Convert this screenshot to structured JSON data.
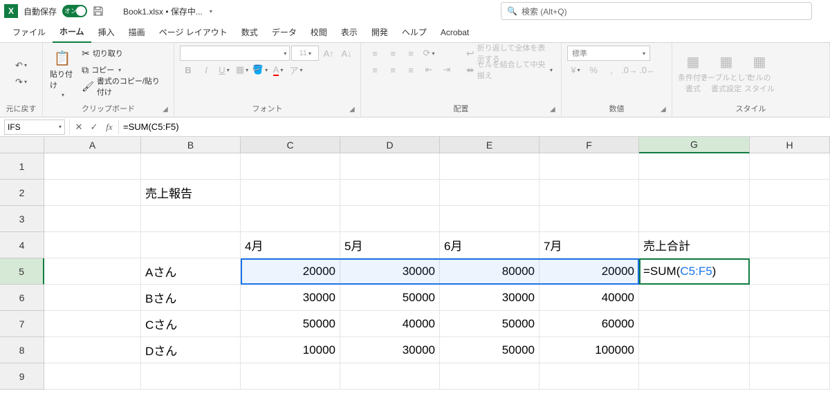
{
  "titlebar": {
    "autosave_label": "自動保存",
    "autosave_on": "オン",
    "file_title": "Book1.xlsx • 保存中...",
    "search_placeholder": "検索 (Alt+Q)"
  },
  "tabs": [
    "ファイル",
    "ホーム",
    "挿入",
    "描画",
    "ページ レイアウト",
    "数式",
    "データ",
    "校閲",
    "表示",
    "開発",
    "ヘルプ",
    "Acrobat"
  ],
  "active_tab": "ホーム",
  "ribbon": {
    "undo_label": "元に戻す",
    "clipboard": {
      "paste": "貼り付け",
      "cut": "切り取り",
      "copy": "コピー",
      "fmtpaint": "書式のコピー/貼り付け",
      "label": "クリップボード"
    },
    "font": {
      "size": "11",
      "label": "フォント"
    },
    "align": {
      "wrap": "折り返して全体を表示する",
      "merge": "セルを結合して中央揃え",
      "label": "配置"
    },
    "number": {
      "fmt": "標準",
      "label": "数値"
    },
    "styles": {
      "cond": "条件付き\n書式",
      "table": "テーブルとして\n書式設定",
      "cell": "セルの\nスタイル",
      "label": "スタイル"
    }
  },
  "name_box": "IFS",
  "formula": {
    "prefix": "=SUM(",
    "ref": "C5:F5",
    "suffix": ")"
  },
  "formula_text": "=SUM(C5:F5)",
  "columns": [
    "A",
    "B",
    "C",
    "D",
    "E",
    "F",
    "G",
    "H"
  ],
  "rows": [
    "1",
    "2",
    "3",
    "4",
    "5",
    "6",
    "7",
    "8",
    "9"
  ],
  "cells": {
    "B2": "売上報告",
    "C4": "4月",
    "D4": "5月",
    "E4": "6月",
    "F4": "7月",
    "G4": "売上合計",
    "B5": "Aさん",
    "C5": "20000",
    "D5": "30000",
    "E5": "80000",
    "F5": "20000",
    "B6": "Bさん",
    "C6": "30000",
    "D6": "50000",
    "E6": "30000",
    "F6": "40000",
    "B7": "Cさん",
    "C7": "50000",
    "D7": "40000",
    "E7": "50000",
    "F7": "60000",
    "B8": "Dさん",
    "C8": "10000",
    "D8": "30000",
    "E8": "50000",
    "F8": "100000"
  },
  "chart_data": {
    "type": "table",
    "title": "売上報告",
    "categories": [
      "4月",
      "5月",
      "6月",
      "7月"
    ],
    "series": [
      {
        "name": "Aさん",
        "values": [
          20000,
          30000,
          80000,
          20000
        ]
      },
      {
        "name": "Bさん",
        "values": [
          30000,
          50000,
          30000,
          40000
        ]
      },
      {
        "name": "Cさん",
        "values": [
          50000,
          40000,
          50000,
          60000
        ]
      },
      {
        "name": "Dさん",
        "values": [
          10000,
          30000,
          50000,
          100000
        ]
      }
    ],
    "sum_column_label": "売上合計"
  },
  "active_cell_ref": "G5",
  "selected_range": "C5:F5"
}
